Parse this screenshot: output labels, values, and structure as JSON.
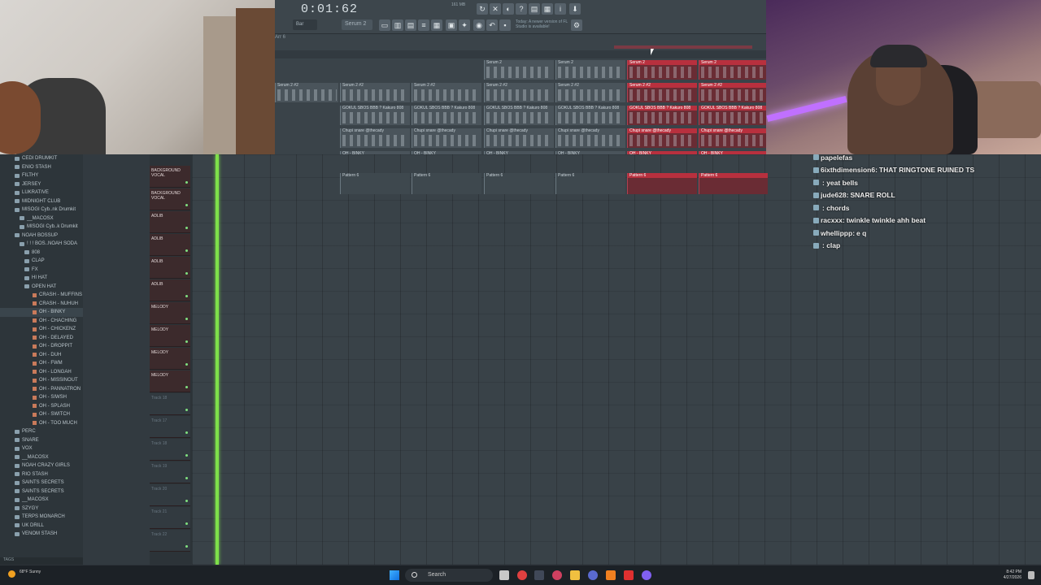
{
  "toolbar": {
    "time": "0:01:62",
    "mode": "Bar",
    "pattern": "Serum 2",
    "news": "Today: A newer version of FL Studio is available!",
    "tempo": "161 MB"
  },
  "arrangement": {
    "label": "Arr 6",
    "clips": [
      {
        "title": "Serum 2"
      },
      {
        "title": "Serum 2 #2"
      },
      {
        "title": "GOKUL SBOS BBB ? Kakuro 808"
      },
      {
        "title": "Chupi snare @thecady"
      },
      {
        "title": "OH - BINKY"
      },
      {
        "title": "Pattern 6"
      }
    ]
  },
  "browser": {
    "items": [
      {
        "label": "CEDI DRUMKIT",
        "type": "folder"
      },
      {
        "label": "ENIO STASH",
        "type": "folder"
      },
      {
        "label": "FILTHY",
        "type": "folder"
      },
      {
        "label": "JERSEY",
        "type": "folder"
      },
      {
        "label": "LUKRATIVE",
        "type": "folder"
      },
      {
        "label": "MIDNIGHT CLUB",
        "type": "folder"
      },
      {
        "label": "MISOGI Cyb..nk Drumkit",
        "type": "folder"
      },
      {
        "label": "__MACOSX",
        "type": "folder"
      },
      {
        "label": "MISOGI Cyb..k Drumkit",
        "type": "folder"
      },
      {
        "label": "NOAH BOSSUP",
        "type": "folder"
      },
      {
        "label": "! ! ! BOS..NOAH SODA",
        "type": "folder"
      },
      {
        "label": "808",
        "type": "folder"
      },
      {
        "label": "CLAP",
        "type": "folder"
      },
      {
        "label": "FX",
        "type": "folder"
      },
      {
        "label": "HI HAT",
        "type": "folder"
      },
      {
        "label": "OPEN HAT",
        "type": "folder"
      },
      {
        "label": "CRASH - MUFFINS",
        "type": "file"
      },
      {
        "label": "CRASH - NUHUH",
        "type": "file"
      },
      {
        "label": "OH - BINKY",
        "type": "file"
      },
      {
        "label": "OH - CHACHING",
        "type": "file"
      },
      {
        "label": "OH - CHICKENZ",
        "type": "file"
      },
      {
        "label": "OH - DELAYED",
        "type": "file"
      },
      {
        "label": "OH - DROPPIT",
        "type": "file"
      },
      {
        "label": "OH - DUH",
        "type": "file"
      },
      {
        "label": "OH - FWM",
        "type": "file"
      },
      {
        "label": "OH - LONGAH",
        "type": "file"
      },
      {
        "label": "OH - MISSINOUT",
        "type": "file"
      },
      {
        "label": "OH - PANNATRON",
        "type": "file"
      },
      {
        "label": "OH - SIWSH",
        "type": "file"
      },
      {
        "label": "OH - SPLASH",
        "type": "file"
      },
      {
        "label": "OH - SWITCH",
        "type": "file"
      },
      {
        "label": "OH - TOO MUCH",
        "type": "file"
      },
      {
        "label": "PERC",
        "type": "folder"
      },
      {
        "label": "SNARE",
        "type": "folder"
      },
      {
        "label": "VOX",
        "type": "folder"
      },
      {
        "label": "__MACOSX",
        "type": "folder"
      },
      {
        "label": "NOAH CRAZY GIRLS",
        "type": "folder"
      },
      {
        "label": "RIO STASH",
        "type": "folder"
      },
      {
        "label": "SAINTS SECRETS",
        "type": "folder"
      },
      {
        "label": "SAINTS SECRETS",
        "type": "folder"
      },
      {
        "label": "__MACOSX",
        "type": "folder"
      },
      {
        "label": "SZYGY",
        "type": "folder"
      },
      {
        "label": "TERPS MONARCH",
        "type": "folder"
      },
      {
        "label": "UK DRILL",
        "type": "folder"
      },
      {
        "label": "VENOM STASH",
        "type": "folder"
      }
    ],
    "footer": "TAGS"
  },
  "tracks": [
    {
      "label": "BACKGROUND VOCAL"
    },
    {
      "label": "BACKGROUND VOCAL"
    },
    {
      "label": "ADLIB"
    },
    {
      "label": "ADLIB"
    },
    {
      "label": "ADLIB"
    },
    {
      "label": "ADLIB"
    },
    {
      "label": "MELODY"
    },
    {
      "label": "MELODY"
    },
    {
      "label": "MELODY"
    },
    {
      "label": "MELODY"
    },
    {
      "label": "Track 18"
    },
    {
      "label": "Track 17"
    },
    {
      "label": "Track 18"
    },
    {
      "label": "Track 19"
    },
    {
      "label": "Track 20"
    },
    {
      "label": "Track 21"
    },
    {
      "label": "Track 22"
    }
  ],
  "chat": [
    {
      "user": "papelefas",
      "text": ""
    },
    {
      "user": "6ixthdimension6:",
      "text": "THAT RINGTONE RUINED TS"
    },
    {
      "user": "",
      "text": ": yeat bells"
    },
    {
      "user": "jude628:",
      "text": "SNARE ROLL"
    },
    {
      "user": "",
      "text": ": chords"
    },
    {
      "user": "racxxx:",
      "text": "twinkle twinkle ahh beat"
    },
    {
      "user": "whellippp:",
      "text": "e q"
    },
    {
      "user": "",
      "text": ": clap"
    }
  ],
  "taskbar": {
    "weather": "68°F Sunny",
    "search": "Search",
    "time": "8:42 PM",
    "date": "4/27/2026"
  },
  "colors": {
    "accent_red": "#b8303e",
    "playhead": "#7ee04a",
    "chat_user_pink": "#e060a0"
  }
}
